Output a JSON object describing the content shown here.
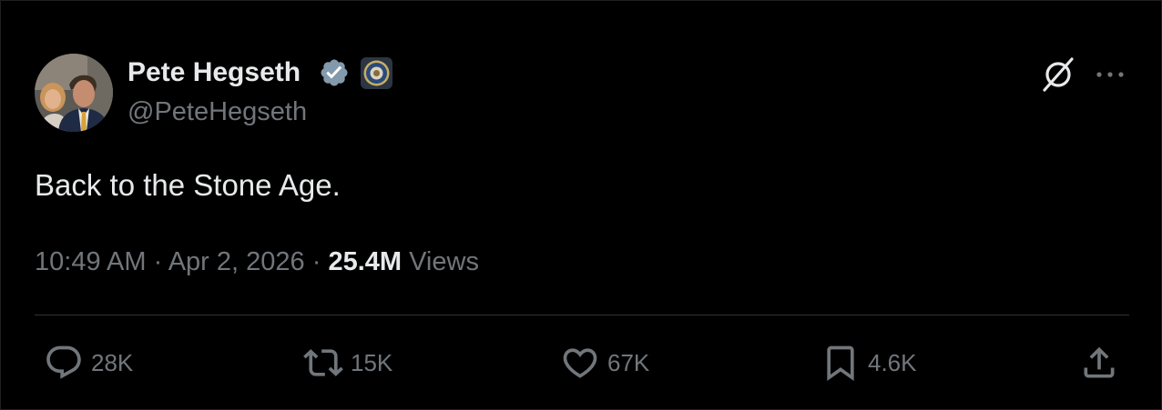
{
  "author": {
    "name": "Pete Hegseth",
    "handle": "@PeteHegseth",
    "verified": true
  },
  "tweet": {
    "text": "Back to the Stone Age.",
    "time": "10:49 AM",
    "date": "Apr 2, 2026",
    "separator": " · ",
    "views_count": "25.4M",
    "views_label": "Views"
  },
  "actions": {
    "replies": "28K",
    "reposts": "15K",
    "likes": "67K",
    "bookmarks": "4.6K"
  },
  "colors": {
    "background": "#000000",
    "text": "#e7e9ea",
    "muted": "#71767b",
    "divider": "#2f3336",
    "verified": "#829aab"
  },
  "icons": [
    "avatar-photo",
    "verified-badge-icon",
    "affiliation-seal-icon",
    "grok-icon",
    "more-icon",
    "reply-icon",
    "repost-icon",
    "like-icon",
    "bookmark-icon",
    "share-icon"
  ]
}
